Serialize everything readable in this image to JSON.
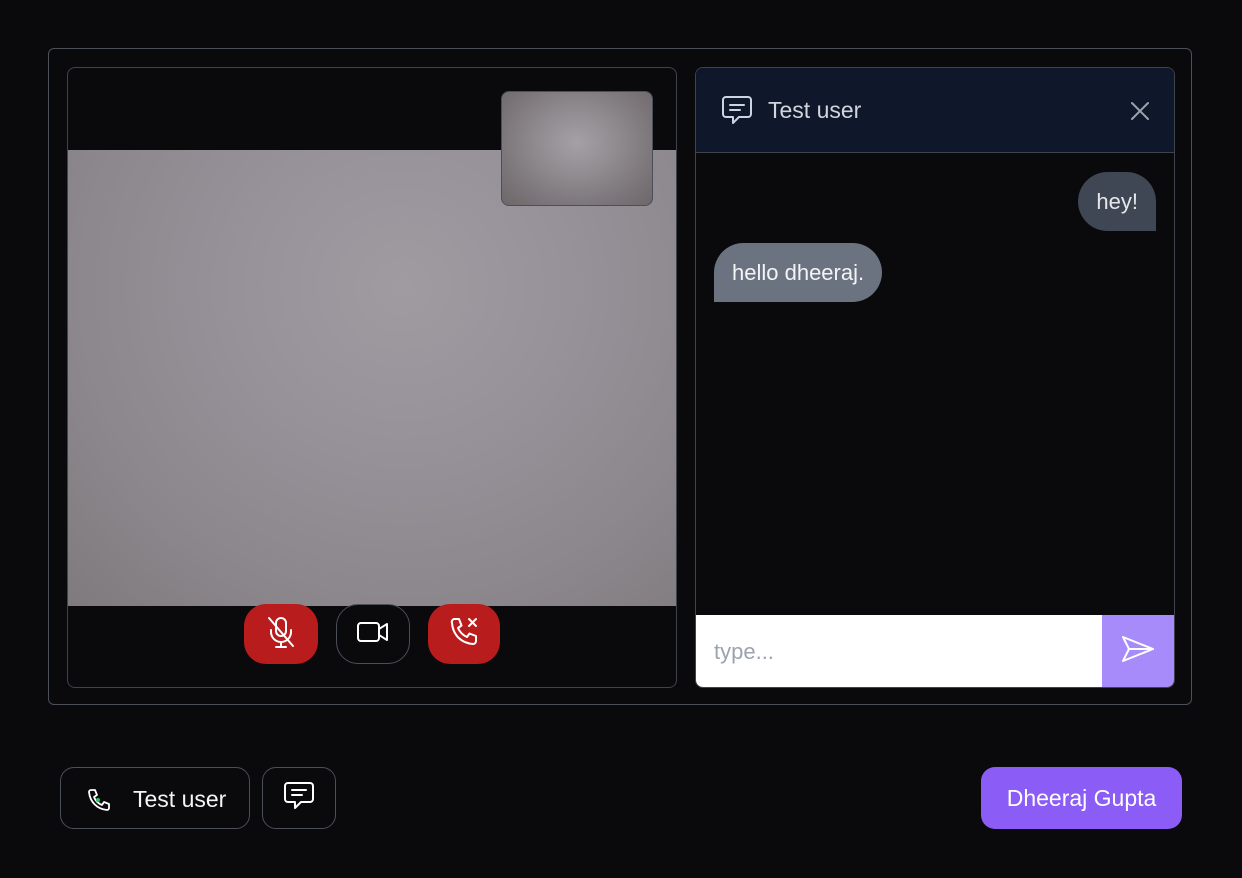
{
  "call": {
    "remote_video_label": "remote-video",
    "controls": {
      "mic_icon": "mic-off-icon",
      "camera_icon": "video-camera-icon",
      "end_call_icon": "phone-x-icon"
    }
  },
  "chat": {
    "header_icon": "chat-bubble-icon",
    "title": "Test user",
    "close_icon": "close-icon",
    "messages": [
      {
        "direction": "outgoing",
        "text": "hey!"
      },
      {
        "direction": "incoming",
        "text": "hello dheeraj."
      }
    ],
    "input": {
      "value": "",
      "placeholder": "type..."
    },
    "send_icon": "send-icon"
  },
  "bottom_bar": {
    "call_user_label": "Test user",
    "call_user_icon": "phone-icon",
    "chat_toggle_icon": "chat-bubble-icon",
    "profile_label": "Dheeraj Gupta"
  },
  "colors": {
    "background": "#0a0a0d",
    "danger": "#b91c1c",
    "accent": "#8b5cf6",
    "send_button": "#a78bfa",
    "chat_header": "#0f172a"
  }
}
